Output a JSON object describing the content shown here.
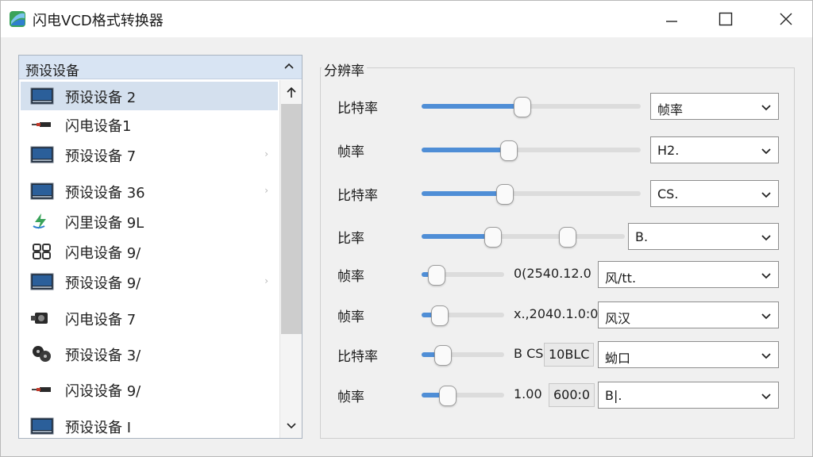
{
  "window": {
    "title": "闪电VCD格式转换器",
    "controls": {
      "minimize": "minimize-icon",
      "maximize": "maximize-icon",
      "close": "close-icon"
    }
  },
  "preset_list": {
    "header": "预设设备",
    "items": [
      {
        "label": "预设设备 2",
        "icon": "monitor-icon",
        "selected": true,
        "has_arrow": false
      },
      {
        "label": "闪电设备1",
        "icon": "cable-icon",
        "selected": false,
        "has_arrow": false
      },
      {
        "label": "预设设备 7",
        "icon": "monitor-icon",
        "selected": false,
        "has_arrow": true
      },
      {
        "label": "预设设备 36",
        "icon": "monitor-icon",
        "selected": false,
        "has_arrow": true
      },
      {
        "label": "闪里设备 9L",
        "icon": "lightning-icon",
        "selected": false,
        "has_arrow": false
      },
      {
        "label": "闪电设备 9/",
        "icon": "grid-icon",
        "selected": false,
        "has_arrow": false
      },
      {
        "label": "预设设备 9/",
        "icon": "monitor-icon",
        "selected": false,
        "has_arrow": true
      },
      {
        "label": "闪电设备 7",
        "icon": "camera-icon",
        "selected": false,
        "has_arrow": false
      },
      {
        "label": "预设设备 3/",
        "icon": "reel-icon",
        "selected": false,
        "has_arrow": false
      },
      {
        "label": "闪设设备 9/",
        "icon": "cable-icon",
        "selected": false,
        "has_arrow": false
      },
      {
        "label": "预设设备 I",
        "icon": "monitor-icon",
        "selected": false,
        "has_arrow": false
      }
    ],
    "arrow_glyph": "›"
  },
  "settings": {
    "group_title": "分辨率",
    "rows": [
      {
        "label": "比特率",
        "level": 0.46,
        "select": "帧率"
      },
      {
        "label": "帧率",
        "level": 0.4,
        "select": "H2."
      },
      {
        "label": "比特率",
        "level": 0.38,
        "select": "CS."
      },
      {
        "label": "比率",
        "level": 0.35,
        "level2": 0.72,
        "select": "B."
      },
      {
        "label": "帧率",
        "level": 0.18,
        "readout": "0(2540.12.0",
        "select": "风/tt."
      },
      {
        "label": "帧率",
        "level": 0.22,
        "readout": "x.,2040.1.0:0",
        "select": "风汉"
      },
      {
        "label": "比特率",
        "level": 0.26,
        "readout": "B CS",
        "box": "10BLC",
        "select": "蚴口"
      },
      {
        "label": "帧率",
        "level": 0.32,
        "readout": "1.00",
        "box": "600:0",
        "select": "B|."
      }
    ]
  },
  "colors": {
    "accent": "#4f8ed6",
    "selected_row": "#d4e0ee",
    "list_header": "#d8e4f3"
  }
}
